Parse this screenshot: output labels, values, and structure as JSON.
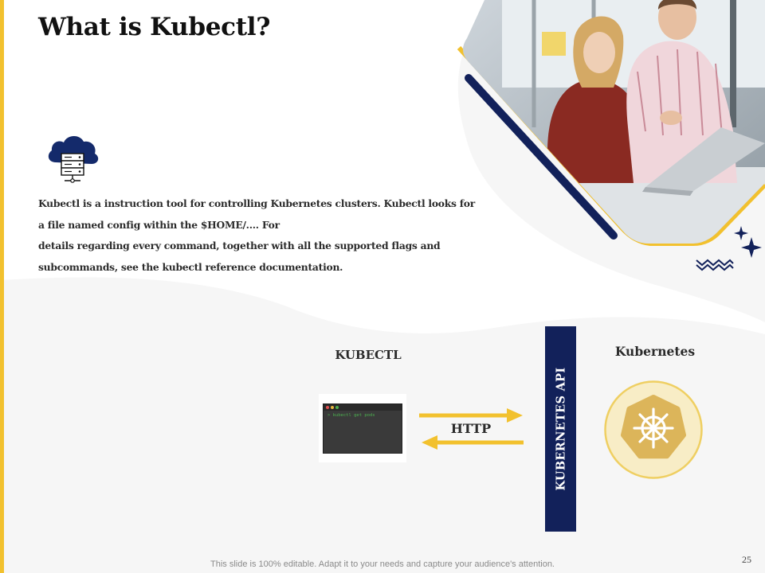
{
  "slide": {
    "title": "What is Kubectl?",
    "description_lines": [
      "Kubectl is a instruction tool for controlling Kubernetes clusters. Kubectl looks for",
      "a file named config within the $HOME/.... For",
      "details regarding every command, together with all the supported flags and",
      "subcommands, see the kubectl reference documentation."
    ],
    "footer_note": "This slide is 100% editable. Adapt it to your needs and capture your audience's attention.",
    "page_number": "25"
  },
  "diagram": {
    "kubectl_label": "KUBECTL",
    "terminal_command": "> kubectl get pods",
    "protocol_label": "HTTP",
    "api_label": "KUBERNETES API",
    "kubernetes_label": "Kubernetes"
  },
  "icons": {
    "cloud": "cloud-server-icon",
    "kubernetes": "kubernetes-helm-icon",
    "sparkles": "sparkle-icon",
    "zigzag": "zigzag-decoration"
  },
  "colors": {
    "accent_yellow": "#f2c12e",
    "navy": "#12215a",
    "k8s_gold": "#dcb55a"
  }
}
